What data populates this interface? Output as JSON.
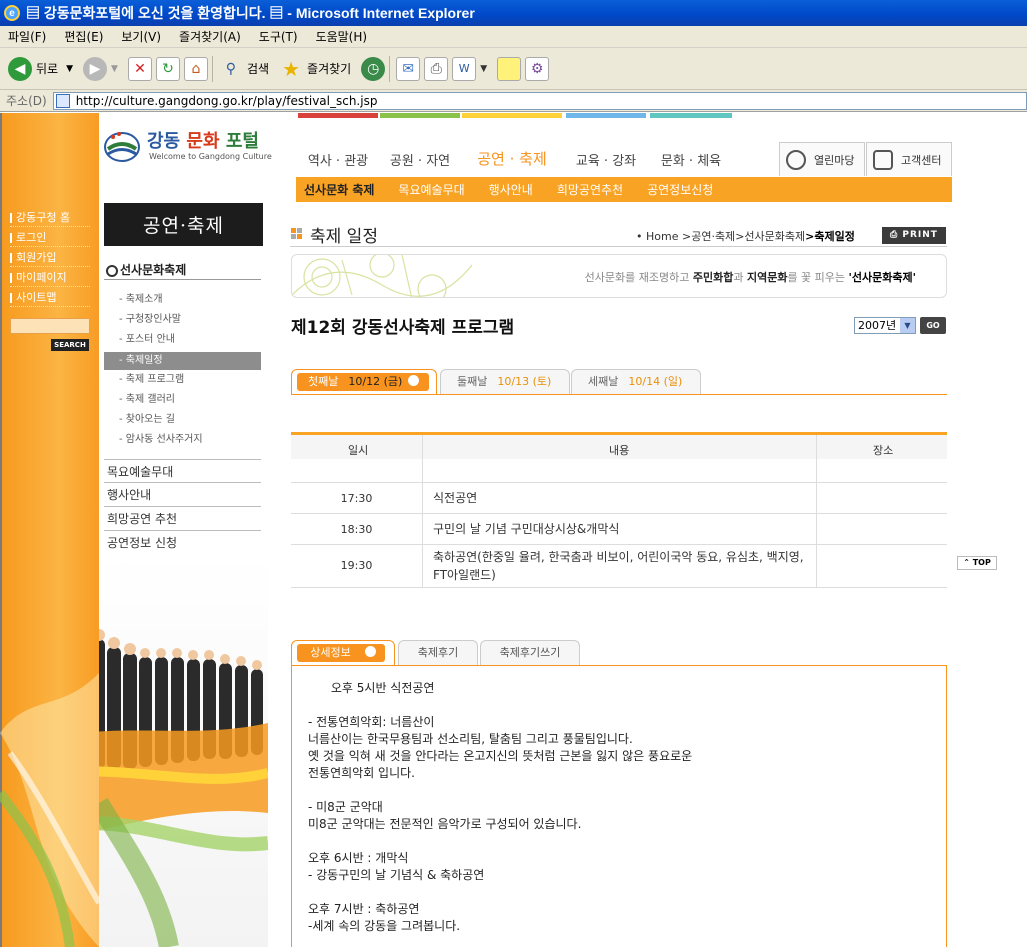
{
  "browser": {
    "title": "▤ 강동문화포털에 오신 것을 환영합니다. ▤ - Microsoft Internet Explorer",
    "menu": [
      "파일(F)",
      "편집(E)",
      "보기(V)",
      "즐겨찾기(A)",
      "도구(T)",
      "도움말(H)"
    ],
    "toolbar": {
      "back": "뒤로",
      "search": "검색",
      "favorites": "즐겨찾기"
    },
    "address_label": "주소(D)",
    "url": "http://culture.gangdong.go.kr/play/festival_sch.jsp"
  },
  "site": {
    "logo_title_1": "강동",
    "logo_title_2": "문화",
    "logo_title_3": "포털",
    "logo_sub": "Welcome to Gangdong Culture",
    "left_links": [
      "강동구청 홈",
      "로그인",
      "회원가입",
      "마이페이지",
      "사이트맵"
    ],
    "search_button": "SEARCH"
  },
  "top_nav": {
    "tabs": [
      "역사 · 관광",
      "공원 · 자연",
      "공연 · 축제",
      "교육 · 강좌",
      "문화 · 체육"
    ],
    "active_index": 2,
    "side_buttons": [
      "열린마당",
      "고객센터"
    ],
    "sub_items": [
      "선사문화 축제",
      "목요예술무대",
      "행사안내",
      "희망공연추천",
      "공연정보신청"
    ]
  },
  "left_menu": {
    "section_banner": "공연·축제",
    "heading": "선사문화축제",
    "sub_items": [
      "- 축제소개",
      "- 구청장인사말",
      "- 포스터 안내",
      "-  축제일정",
      "- 축제 프로그램",
      "- 축제 갤러리",
      "- 찾아오는 길",
      "- 암사동 선사주거지"
    ],
    "active_sub_index": 3,
    "main_items": [
      "목요예술무대",
      "행사안내",
      "희망공연 추천",
      "공연정보 신청"
    ]
  },
  "content": {
    "page_title": "축제 일정",
    "breadcrumb": [
      "• Home",
      ">공연·축제",
      ">선사문화축제",
      ">축제일정"
    ],
    "print_label": "PRINT",
    "slogan_pre": "선사문화를 재조명하고 ",
    "slogan_b1": "주민화합",
    "slogan_mid1": "과 ",
    "slogan_b2": "지역문화",
    "slogan_mid2": "를 꽃 피우는 ",
    "slogan_hl": "'선사문화축제'",
    "program_title": "제12회 강동선사축제 프로그램",
    "year_value": "2007년",
    "go_label": "GO",
    "day_tabs": [
      {
        "name": "첫째날",
        "date": "10/12 (금)"
      },
      {
        "name": "둘째날",
        "date": "10/13 (토)"
      },
      {
        "name": "세째날",
        "date": "10/14 (일)"
      }
    ],
    "schedule_headers": [
      "일시",
      "내용",
      "장소"
    ],
    "schedule_rows": [
      {
        "time": "17:30",
        "content": "식전공연"
      },
      {
        "time": "18:30",
        "content": "구민의 날 기념 구민대상시상&개막식"
      },
      {
        "time": "19:30",
        "content": "축하공연(한중일 율려, 한국춤과 비보이, 어린이국악 동요, 유심초, 백지영, FT아일랜드)"
      }
    ],
    "top_label": "TOP",
    "info_tabs": [
      "상세정보",
      "축제후기",
      "축제후기쓰기"
    ],
    "info_lines": [
      "      오후 5시반 식전공연",
      "",
      "- 전통연희악회: 너름산이",
      "너름산이는 한국무용팀과 선소리팀, 탈춤팀 그리고 풍물팀입니다.",
      "옛 것을 익혀 새 것을 안다라는 온고지신의 뜻처럼 근본을 잃지 않은 풍요로운",
      "전통연희악회 입니다.",
      "",
      "- 미8군 군악대",
      "미8군 군악대는 전문적인 음악가로 구성되어 있습니다.",
      "",
      "오후 6시반 : 개막식",
      "- 강동구민의 날 기념식 & 축하공연",
      "",
      "오후 7시반 : 축하공연",
      "-세계 속의 강동을 그려봅니다."
    ]
  },
  "colors": {
    "accent": "#f7931e",
    "subnav": "#f9a325",
    "ie_title": "#0049c9"
  }
}
